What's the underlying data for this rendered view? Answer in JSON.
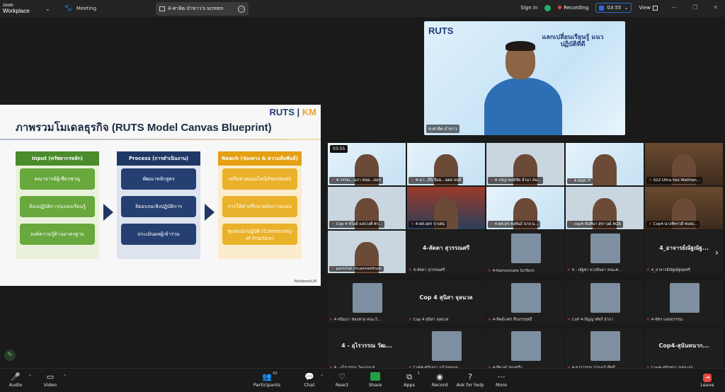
{
  "app": {
    "logo_top": "zoom",
    "logo_bottom": "Workplace"
  },
  "titlebar": {
    "meeting_label": "Meeting",
    "screen_tab": "4-ศาลิต บำขาว's screen",
    "signin": "Sign in",
    "recording": "Recording",
    "timer": "03:55",
    "view": "View"
  },
  "slide": {
    "brand_a": "RUTS",
    "brand_b": "KM",
    "title": "ภาพรวมโมเดลธุรกิจ (RUTS Model Canvas Blueprint)",
    "columns": [
      {
        "head": "Input (ทรัพยากรหลัก)",
        "items": [
          "คณาจารย์ผู้เชี่ยวชาญ",
          "ห้องปฏิบัติการ/แปลงเรียนรู้",
          "องค์ความรู้ด้านมาตรฐาน"
        ]
      },
      {
        "head": "Process (การดำเนินงาน)",
        "items": [
          "พัฒนาหลักสูตร",
          "จัดอบรมเชิงปฏิบัติการ",
          "ประเมินผลผู้เข้าร่วม"
        ]
      },
      {
        "head": "Reach (ช่องทาง & ความสัมพันธ์)",
        "items": [
          "เครือข่ายออนไลน์/Facebook",
          "การให้คำปรึกษาหลังการอบรม",
          "ชุมชนนักปฏิบัติ (Community of Practice)"
        ]
      }
    ],
    "footer": "NotebookLM"
  },
  "speaker": {
    "rutsbig": "RUTS",
    "banner": "แลกเปลี่ยนเรียนรู้ แนวปฏิบัติที่ดี",
    "name": "4-ศาลิต บำขาว"
  },
  "tiles": [
    {
      "name": "4-วรรณ...นภา หนม...ยอก",
      "kind": "banner-bg"
    },
    {
      "name": "4-นา...ถีนิ จิมม...นผล จนปี",
      "kind": "banner-bg"
    },
    {
      "name": "4-ปรุญาพงษ์ชัย อำนา สน...",
      "kind": "face"
    },
    {
      "name": "4-AGR IT",
      "kind": "banner-bg"
    },
    {
      "name": "S22 Ultra ของ Walthan...",
      "kind": "room"
    },
    {
      "name": "Cop 4 ชไมย์ แสงวงศ์ ศก...",
      "kind": "face"
    },
    {
      "name": "4-ผศ.อดร บ่าเด่น",
      "kind": "red"
    },
    {
      "name": "4-ผศ.ดร.ชงพันธ์ นาย ม...",
      "kind": "banner-bg"
    },
    {
      "name": "cop4-จันทินา สุขาวุฒิ AGR",
      "kind": "face"
    },
    {
      "name": "Cop4-นางทิพรวดี ทองม...",
      "kind": "room"
    },
    {
      "name": "parichat chuanrakthum",
      "kind": "face"
    },
    {
      "name": "4-ลัดดา สุวรรณศรี",
      "kind": "avatar",
      "big": "4-ลัดดา สุวรรณศรี"
    },
    {
      "name": "4-Kamonnate SciTech",
      "kind": "avatar"
    },
    {
      "name": "4 - ณัฐชา ดวงจินดา คณะศ...",
      "kind": "avatar"
    },
    {
      "name": "4_อาจารย์ณัฐณัฐชุมศรี",
      "kind": "avatar",
      "big": "4_อาจารย์ณัฐณัฐ..."
    },
    {
      "name": "4-ชนิมภา ช่องหาย คณะวิ...",
      "kind": "avatar"
    },
    {
      "name": "Cop 4 สุนิสา จุลนวล",
      "kind": "avatar",
      "big": "Cop 4 สุนิสา จุลนวล"
    },
    {
      "name": "4-ทิพย์เกศร สืบบรรฤทธิ์",
      "kind": "avatar"
    },
    {
      "name": "CoP 4-ปัญญาพัชร์ อำภา",
      "kind": "avatar"
    },
    {
      "name": "4-พัชร แสงสุวรรณ",
      "kind": "avatar"
    },
    {
      "name": "4 - อุไรวรรณ วัฒนกุล ศ...",
      "kind": "avatar",
      "big": "4 - อุไรวรรณ วัฒ..."
    },
    {
      "name": "CoP4-ศรัญญา แก้วมพลงอ",
      "kind": "avatar"
    },
    {
      "name": "4-ทิพวุฒิ ทองพรึก",
      "kind": "avatar"
    },
    {
      "name": "4-จารุวรรณ ปานแก้วสิทธิ์",
      "kind": "avatar"
    },
    {
      "name": "Cop4-สุนันทนา ผุลขะอก...",
      "kind": "avatar",
      "big": "Cop4-สุนันทนาก..."
    }
  ],
  "tile_timer": "03:55",
  "toolbar": {
    "audio": "Audio",
    "video": "Video",
    "participants": "Participants",
    "participants_count": "42",
    "chat": "Chat",
    "react": "React",
    "share": "Share",
    "apps": "Apps",
    "apps_count": "1",
    "record": "Record",
    "help": "Ask for help",
    "more": "More",
    "leave": "Leave"
  }
}
